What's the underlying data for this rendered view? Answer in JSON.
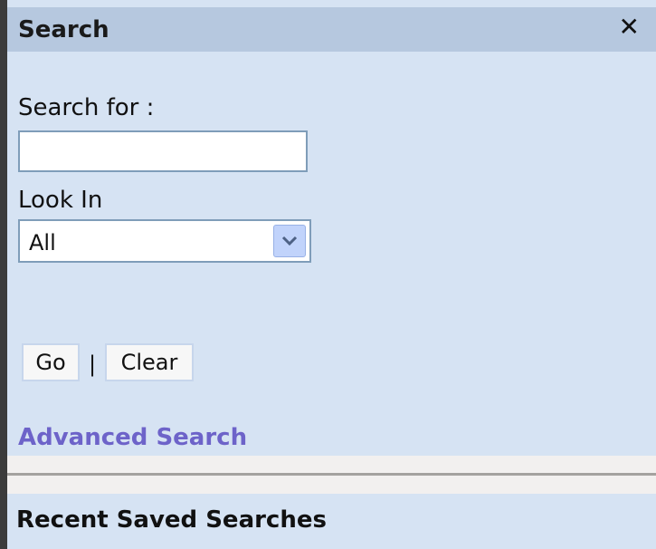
{
  "panel": {
    "title": "Search",
    "close_glyph": "✕"
  },
  "search": {
    "search_for_label": "Search for :",
    "query_value": "",
    "look_in_label": "Look In",
    "look_in_selected": "All",
    "go_label": "Go",
    "separator": "|",
    "clear_label": "Clear",
    "advanced_link": "Advanced Search"
  },
  "recent": {
    "title": "Recent Saved Searches"
  },
  "colors": {
    "panel_bg": "#d6e3f3",
    "titlebar_bg": "#b6c8df",
    "link": "#6d63c9"
  },
  "icons": {
    "close": "close-icon",
    "dropdown": "chevron-down-icon"
  }
}
